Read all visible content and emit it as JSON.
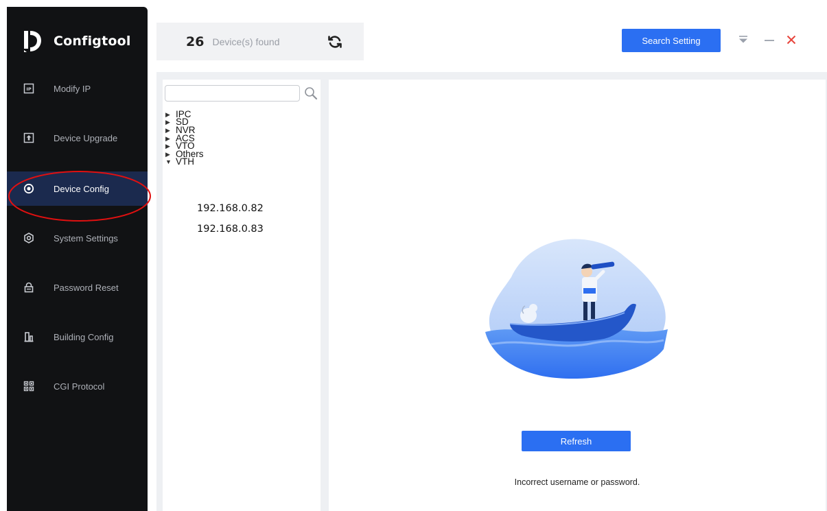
{
  "app": {
    "name": "Configtool"
  },
  "sidebar": {
    "items": [
      {
        "label": "Modify IP",
        "icon": "ip-icon",
        "active": false
      },
      {
        "label": "Device Upgrade",
        "icon": "upload-icon",
        "active": false
      },
      {
        "label": "Device Config",
        "icon": "target-icon",
        "active": true
      },
      {
        "label": "System Settings",
        "icon": "hexagon-settings-icon",
        "active": false
      },
      {
        "label": "Password Reset",
        "icon": "lock-icon",
        "active": false
      },
      {
        "label": "Building Config",
        "icon": "building-icon",
        "active": false
      },
      {
        "label": "CGI Protocol",
        "icon": "qr-grid-icon",
        "active": false
      }
    ]
  },
  "header": {
    "device_count": "26",
    "device_count_label": "Device(s) found",
    "search_setting_label": "Search Setting"
  },
  "tree": {
    "search_placeholder": "",
    "categories": [
      {
        "label": "IPC",
        "expanded": false
      },
      {
        "label": "SD",
        "expanded": false
      },
      {
        "label": "NVR",
        "expanded": false
      },
      {
        "label": "ACS",
        "expanded": false
      },
      {
        "label": "VTO",
        "expanded": false
      },
      {
        "label": "Others",
        "expanded": false
      },
      {
        "label": "VTH",
        "expanded": true
      }
    ],
    "vth_children": [
      "192.168.0.82",
      "192.168.0.83"
    ]
  },
  "main": {
    "refresh_label": "Refresh",
    "status_message": "Incorrect username or password."
  },
  "colors": {
    "accent": "#2b6ff2",
    "sidebar_bg": "#111214",
    "sidebar_active": "#1b2a4e",
    "annotation_red": "#e01010",
    "close_red": "#e8453c"
  }
}
